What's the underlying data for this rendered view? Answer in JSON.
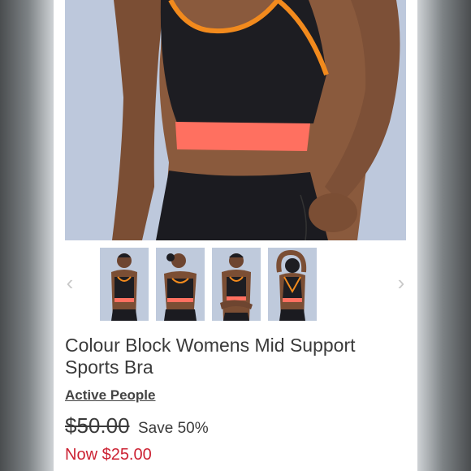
{
  "product": {
    "title": "Colour Block Womens Mid Support Sports Bra",
    "brand": "Active People",
    "original_price": "$50.00",
    "discount": "Save 50%",
    "sale_price": "Now $25.00"
  },
  "gallery": {
    "main_image": "sports-bra-front-closeup",
    "thumbnails": [
      "front-view",
      "side-pose-view",
      "arms-crossed-view",
      "back-view"
    ],
    "prev_icon": "chevron-left-icon",
    "next_icon": "chevron-right-icon"
  },
  "colors": {
    "bra_body": "#1d1d22",
    "trim_orange": "#f28a1d",
    "band_coral": "#ff7060",
    "skin": "#8a5a3d",
    "sale_red": "#cc2233"
  }
}
